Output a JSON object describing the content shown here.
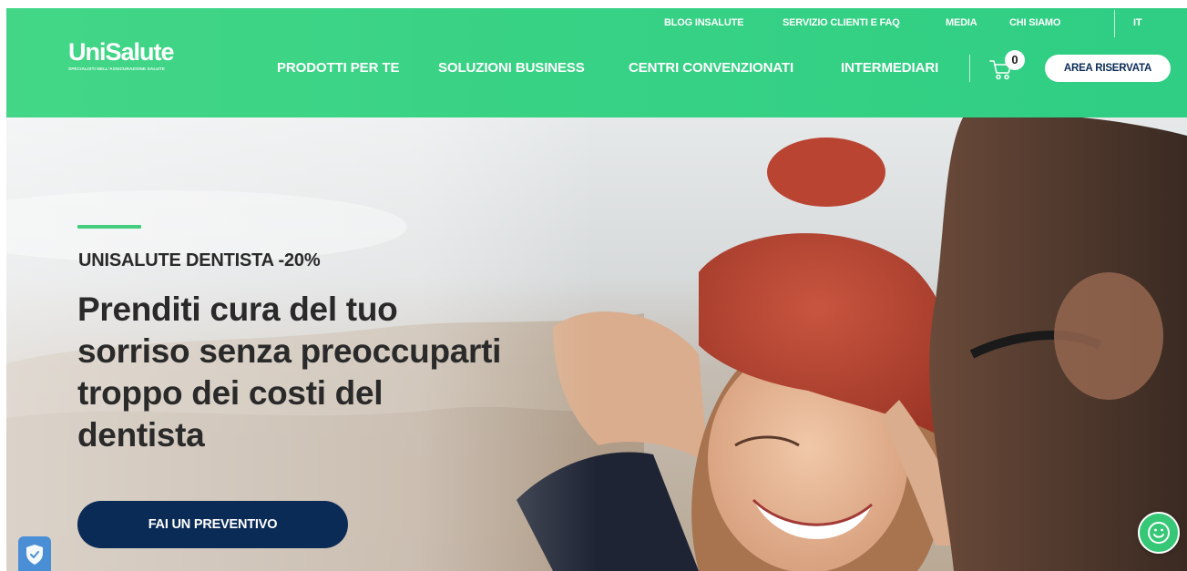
{
  "brand": {
    "name": "UniSalute",
    "tagline": "SPECIALISTI NELL'ASSICURAZIONE SALUTE"
  },
  "top_links": [
    "BLOG INSALUTE",
    "SERVIZIO CLIENTI E FAQ",
    "MEDIA",
    "CHI SIAMO"
  ],
  "language": "IT",
  "main_nav": [
    "PRODOTTI PER TE",
    "SOLUZIONI BUSINESS",
    "CENTRI CONVENZIONATI",
    "INTERMEDIARI"
  ],
  "cart": {
    "count": "0"
  },
  "area_riservata": "AREA RISERVATA",
  "hero": {
    "eyebrow": "UNISALUTE DENTISTA -20%",
    "headline": "Prenditi cura del tuo sorriso senza preoccuparti troppo dei costi del dentista",
    "cta": "FAI UN PREVENTIVO"
  },
  "icons": {
    "cart": "cart-icon",
    "shield": "shield-check-icon",
    "chat": "smiley-chat-icon"
  },
  "colors": {
    "header_green": "#38d285",
    "accent_green": "#43cd7c",
    "navy": "#0b2b57",
    "text_dark": "#2a2a2a"
  }
}
